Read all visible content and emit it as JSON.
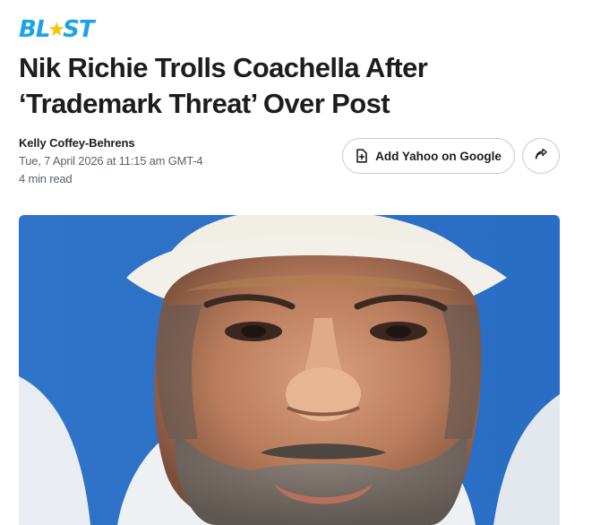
{
  "logo": {
    "left_text": "BL",
    "right_text": "ST",
    "star_glyph": "★",
    "brand_color": "#1aa3e8",
    "star_color": "#f5c400"
  },
  "article": {
    "headline": "Nik Richie Trolls Coachella After ‘Trademark Threat’ Over Post",
    "author": "Kelly Coffey-Behrens",
    "published": "Tue, 7 April 2026 at 11:15 am GMT-4",
    "read_time": "4 min read"
  },
  "actions": {
    "add_source_label": "Add Yahoo on Google",
    "add_source_icon": "add-document-icon",
    "share_icon": "share-arrow-icon"
  },
  "hero_image": {
    "subject": "selfie-photo"
  }
}
